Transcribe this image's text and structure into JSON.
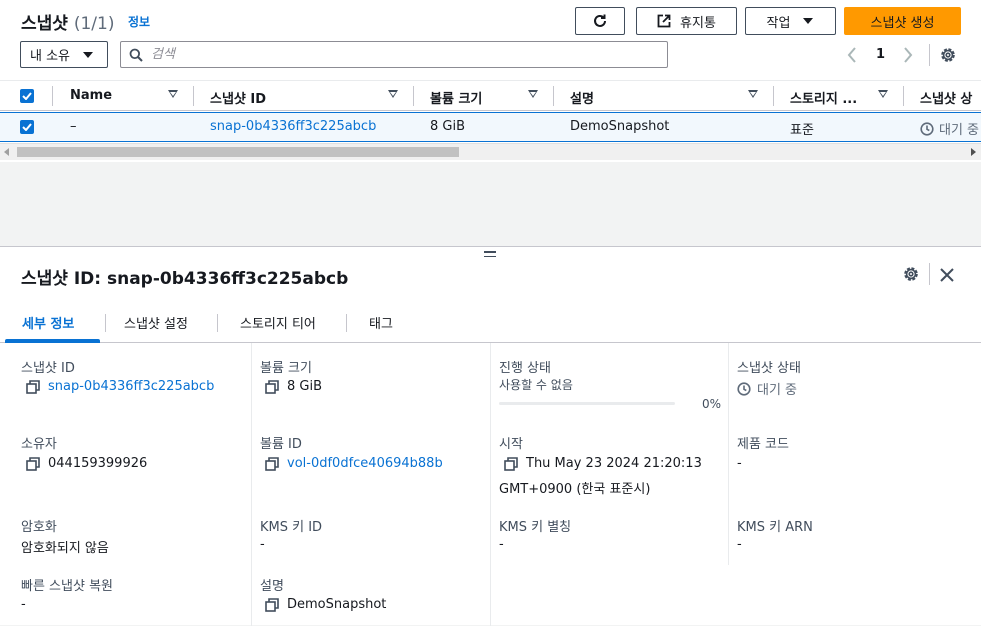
{
  "list": {
    "title": "스냅샷",
    "count": "(1/1)",
    "info_link": "정보",
    "buttons": {
      "recycle_bin": "휴지통",
      "actions": "작업",
      "create": "스냅샷 생성"
    },
    "filter": {
      "owner_value": "내 소유",
      "search_placeholder": "검색"
    },
    "pager": {
      "current_page": "1"
    },
    "columns": [
      "Name",
      "스냅샷 ID",
      "볼륨 크기",
      "설명",
      "스토리지 ...",
      "스냅샷 상"
    ],
    "rows": [
      {
        "name": "–",
        "snapshot_id": "snap-0b4336ff3c225abcb",
        "volume_size": "8 GiB",
        "description": "DemoSnapshot",
        "storage_tier": "표준",
        "state": "대기 중"
      }
    ]
  },
  "details": {
    "title": "스냅샷 ID: snap-0b4336ff3c225abcb",
    "tabs": [
      "세부 정보",
      "스냅샷 설정",
      "스토리지 티어",
      "태그"
    ],
    "fields": {
      "snapshot_id_label": "스냅샷 ID",
      "snapshot_id_value": "snap-0b4336ff3c225abcb",
      "volume_size_label": "볼륨 크기",
      "volume_size_value": "8 GiB",
      "progress_label": "진행 상태",
      "progress_status": "사용할 수 없음",
      "progress_percent": "0%",
      "progress_fraction": 0,
      "state_label": "스냅샷 상태",
      "state_value": "대기 중",
      "owner_label": "소유자",
      "owner_value": "044159399926",
      "volume_id_label": "볼륨 ID",
      "volume_id_value": "vol-0df0dfce40694b88b",
      "start_label": "시작",
      "start_value_line1": "Thu May 23 2024 21:20:13",
      "start_value_line2": "GMT+0900 (한국 표준시)",
      "product_code_label": "제품 코드",
      "product_code_value": "-",
      "encryption_label": "암호화",
      "encryption_value": "암호화되지 않음",
      "kms_id_label": "KMS 키 ID",
      "kms_id_value": "-",
      "kms_alias_label": "KMS 키 별칭",
      "kms_alias_value": "-",
      "kms_arn_label": "KMS 키 ARN",
      "kms_arn_value": "-",
      "fast_restore_label": "빠른 스냅샷 복원",
      "fast_restore_value": "-",
      "description_label": "설명",
      "description_value": "DemoSnapshot"
    }
  },
  "colors": {
    "accent": "#0972d3",
    "primary_button": "#ff9900",
    "selected_row": "#f2f8fd"
  }
}
